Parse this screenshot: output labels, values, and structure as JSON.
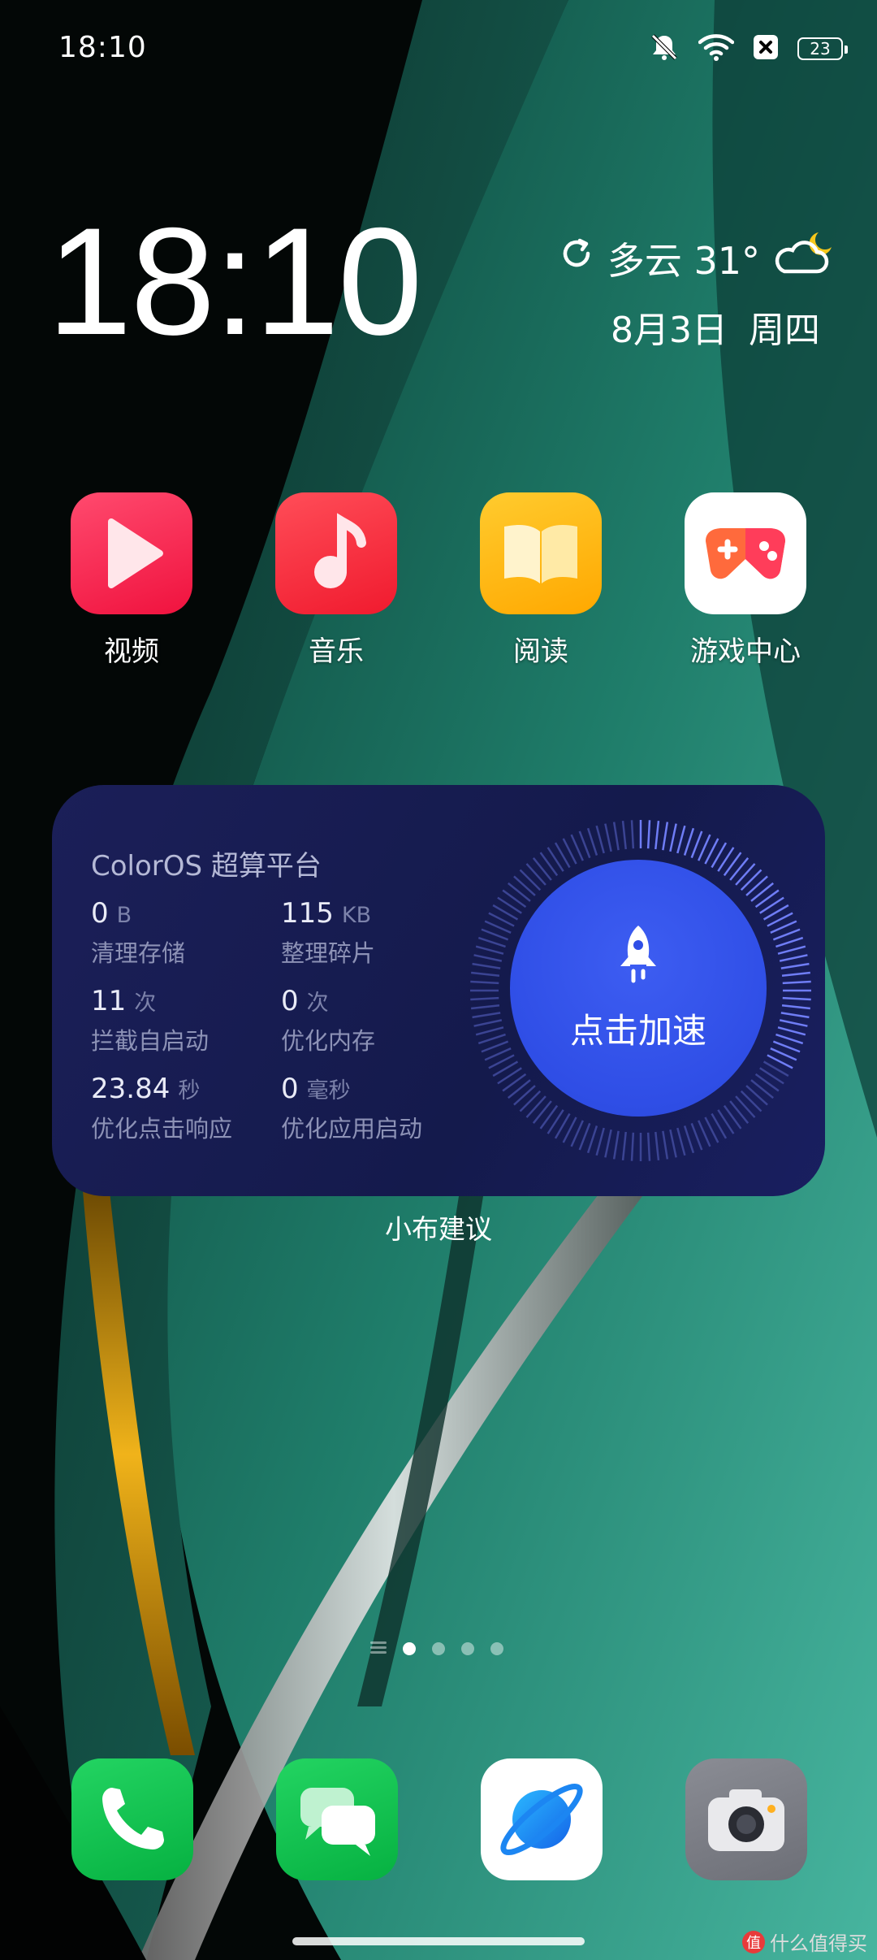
{
  "status_bar": {
    "time": "18:10",
    "battery": "23",
    "icons": [
      "mute-bell-icon",
      "wifi-icon",
      "sim-blocked-icon",
      "battery-icon"
    ]
  },
  "clock_widget": {
    "time": "18:10",
    "weather": "多云 31°",
    "date": "8月3日",
    "weekday": "周四",
    "icons": [
      "refresh-icon",
      "cloud-moon-icon"
    ]
  },
  "apps": [
    {
      "label": "视频",
      "icon": "video-play-icon",
      "color": "#ff2a55"
    },
    {
      "label": "音乐",
      "icon": "music-note-icon",
      "color": "#ff2d3f"
    },
    {
      "label": "阅读",
      "icon": "book-icon",
      "color": "#ffb400"
    },
    {
      "label": "游戏中心",
      "icon": "gamepad-icon",
      "color": "#ffffff"
    }
  ],
  "boost_widget": {
    "title": "ColorOS 超算平台",
    "stats": [
      {
        "value": "0",
        "unit": "B",
        "desc": "清理存储"
      },
      {
        "value": "115",
        "unit": "KB",
        "desc": "整理碎片"
      },
      {
        "value": "11",
        "unit": "次",
        "desc": "拦截自启动"
      },
      {
        "value": "0",
        "unit": "次",
        "desc": "优化内存"
      },
      {
        "value": "23.84",
        "unit": "秒",
        "desc": "优化点击响应"
      },
      {
        "value": "0",
        "unit": "毫秒",
        "desc": "优化应用启动"
      }
    ],
    "button_label": "点击加速",
    "caption": "小布建议",
    "icon": "rocket-icon"
  },
  "page_indicator": {
    "pages": 4,
    "active": 1
  },
  "dock": [
    {
      "name": "phone",
      "icon": "phone-icon",
      "color": "#0fc24d"
    },
    {
      "name": "messages",
      "icon": "chat-bubbles-icon",
      "color": "#10c54f"
    },
    {
      "name": "browser",
      "icon": "planet-icon",
      "color": "#ffffff"
    },
    {
      "name": "camera",
      "icon": "camera-icon",
      "color": "#7c7e86"
    }
  ],
  "watermark": {
    "badge": "值",
    "text": "什么值得买"
  }
}
